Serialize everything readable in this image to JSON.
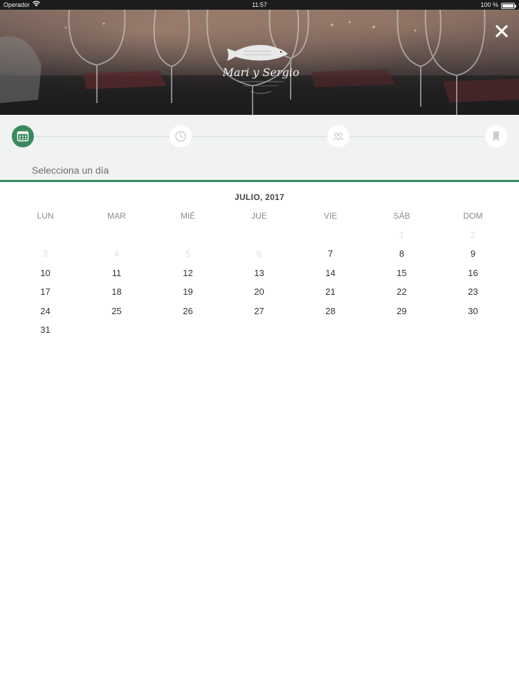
{
  "status_bar": {
    "carrier": "Operador",
    "time": "11:57",
    "battery": "100 %",
    "battery_level": 1.0
  },
  "header": {
    "logo_text": "Mari y Sergio"
  },
  "stepper": {
    "instruction": "Selecciona un día",
    "steps": [
      {
        "icon": "calendar-icon",
        "active": true
      },
      {
        "icon": "clock-icon",
        "active": false
      },
      {
        "icon": "people-icon",
        "active": false
      },
      {
        "icon": "bookmark-icon",
        "active": false
      }
    ]
  },
  "calendar": {
    "month_label": "JULIO, 2017",
    "weekdays": [
      "LUN",
      "MAR",
      "MIÉ",
      "JUE",
      "VIE",
      "SÁB",
      "DOM"
    ],
    "weeks": [
      [
        null,
        null,
        null,
        null,
        null,
        {
          "d": "1",
          "disabled": true
        },
        {
          "d": "2",
          "disabled": true
        }
      ],
      [
        {
          "d": "3",
          "disabled": true
        },
        {
          "d": "4",
          "disabled": true
        },
        {
          "d": "5",
          "disabled": true
        },
        {
          "d": "6",
          "disabled": true
        },
        {
          "d": "7",
          "disabled": false
        },
        {
          "d": "8",
          "disabled": false
        },
        {
          "d": "9",
          "disabled": false
        }
      ],
      [
        {
          "d": "10",
          "disabled": false
        },
        {
          "d": "11",
          "disabled": false
        },
        {
          "d": "12",
          "disabled": false
        },
        {
          "d": "13",
          "disabled": false
        },
        {
          "d": "14",
          "disabled": false
        },
        {
          "d": "15",
          "disabled": false
        },
        {
          "d": "16",
          "disabled": false
        }
      ],
      [
        {
          "d": "17",
          "disabled": false
        },
        {
          "d": "18",
          "disabled": false
        },
        {
          "d": "19",
          "disabled": false
        },
        {
          "d": "20",
          "disabled": false
        },
        {
          "d": "21",
          "disabled": false
        },
        {
          "d": "22",
          "disabled": false
        },
        {
          "d": "23",
          "disabled": false
        }
      ],
      [
        {
          "d": "24",
          "disabled": false
        },
        {
          "d": "25",
          "disabled": false
        },
        {
          "d": "26",
          "disabled": false
        },
        {
          "d": "27",
          "disabled": false
        },
        {
          "d": "28",
          "disabled": false
        },
        {
          "d": "29",
          "disabled": false
        },
        {
          "d": "30",
          "disabled": false
        }
      ],
      [
        {
          "d": "31",
          "disabled": false
        },
        null,
        null,
        null,
        null,
        null,
        null
      ]
    ]
  },
  "colors": {
    "accent": "#3a8a5e",
    "stepper_bg": "#f1f2f2",
    "disabled_day": "#e2e2e2"
  }
}
